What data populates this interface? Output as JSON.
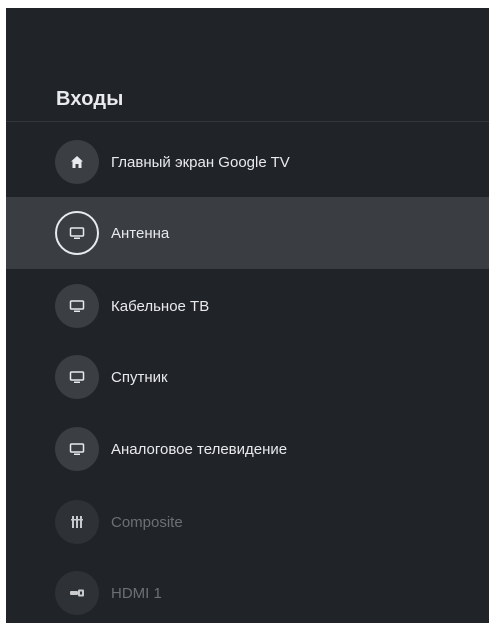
{
  "header": {
    "title": "Входы"
  },
  "items": [
    {
      "label": "Главный экран Google TV",
      "icon": "home-icon",
      "state": "normal"
    },
    {
      "label": "Антенна",
      "icon": "tv-icon",
      "state": "focused"
    },
    {
      "label": "Кабельное ТВ",
      "icon": "tv-icon",
      "state": "normal"
    },
    {
      "label": "Спутник",
      "icon": "tv-icon",
      "state": "normal"
    },
    {
      "label": "Аналоговое телевидение",
      "icon": "tv-icon",
      "state": "normal"
    },
    {
      "label": "Composite",
      "icon": "composite-icon",
      "state": "disabled"
    },
    {
      "label": "HDMI 1",
      "icon": "hdmi-icon",
      "state": "disabled"
    }
  ],
  "colors": {
    "panel_background": "#202327",
    "focused_background": "#3a3e42",
    "icon_circle": "#3b3f43",
    "text_primary": "#e8eaed",
    "text_disabled": "#6c7075"
  }
}
